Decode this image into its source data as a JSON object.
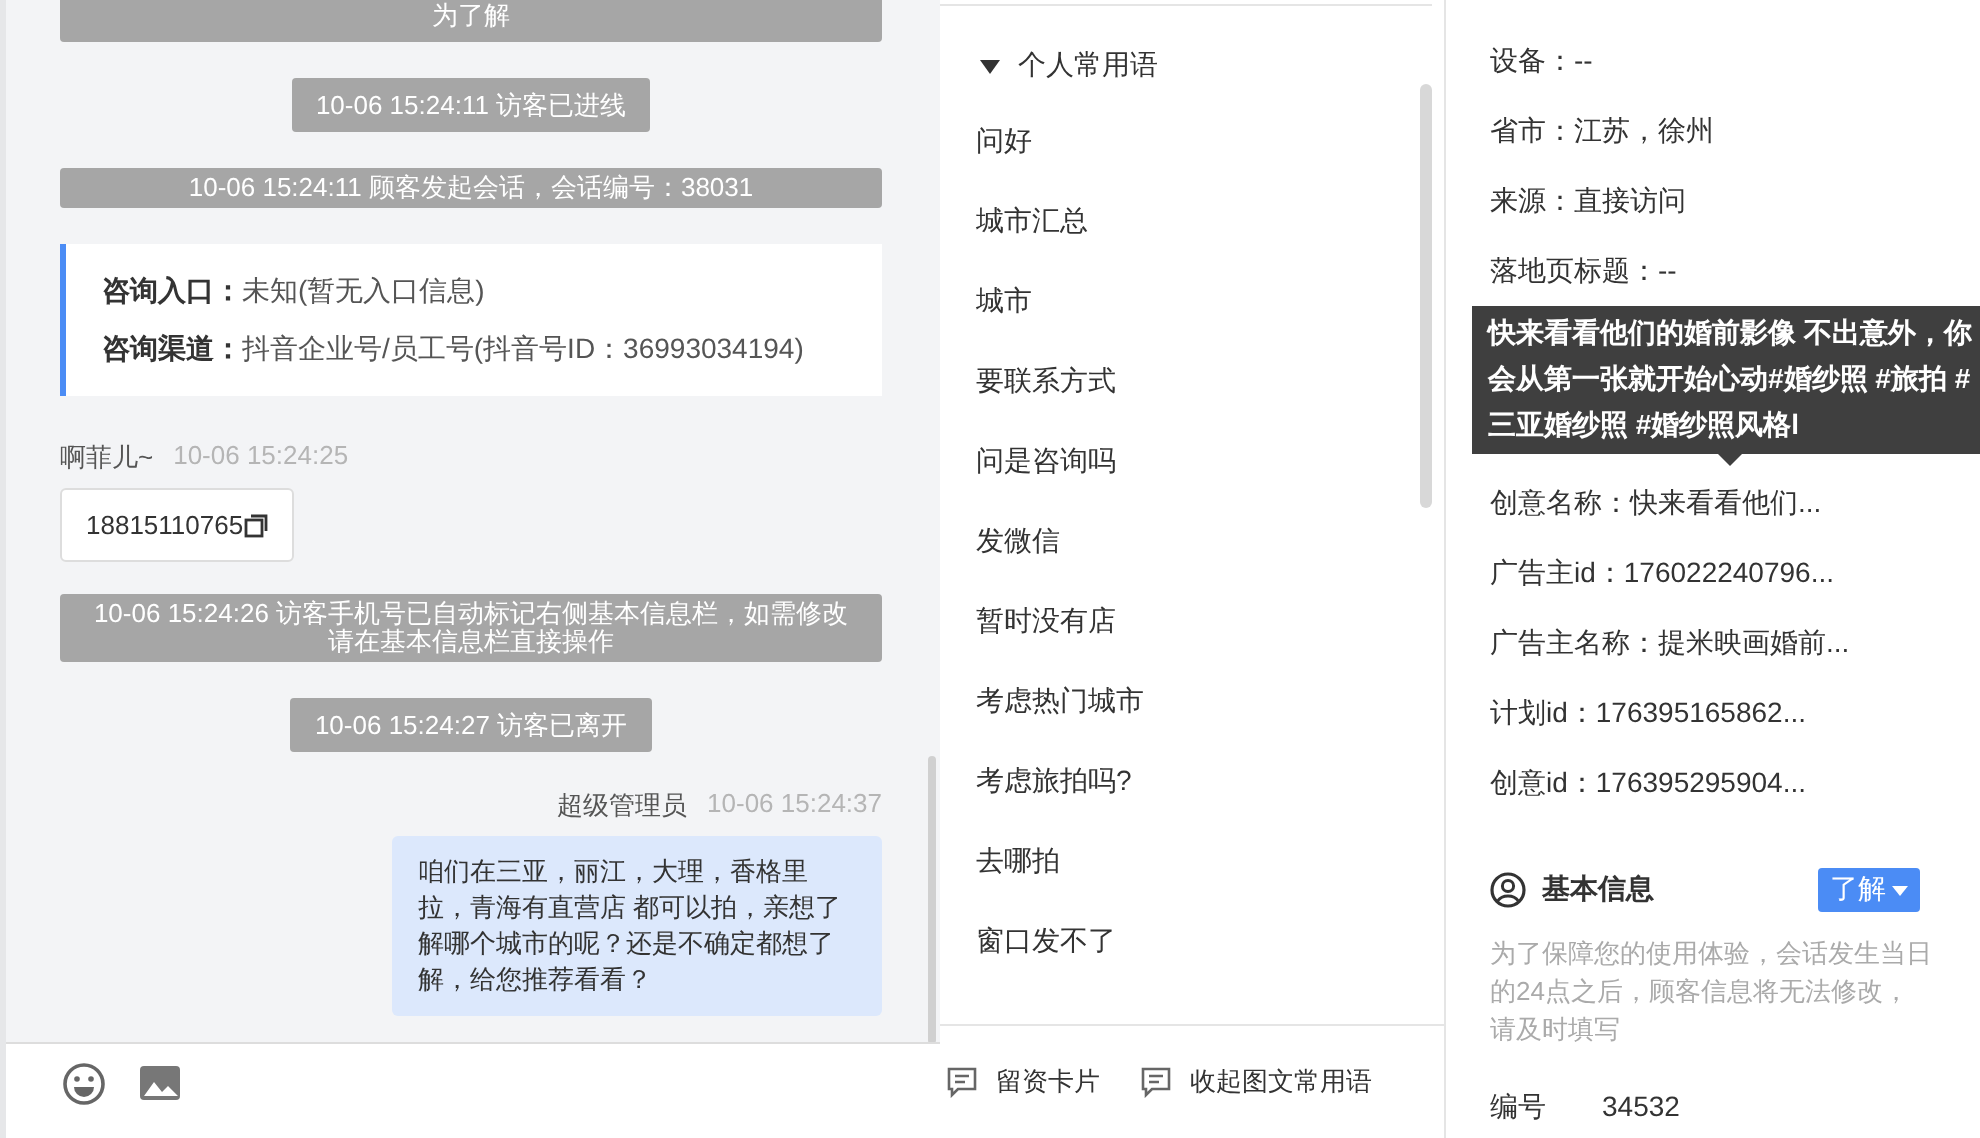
{
  "chat": {
    "messages": [
      {
        "kind": "system",
        "text": "为了解"
      },
      {
        "kind": "system",
        "text": "10-06 15:24:11 访客已进线"
      },
      {
        "kind": "system",
        "text": "10-06 15:24:11 顾客发起会话，会话编号：38031"
      },
      {
        "kind": "source",
        "fields": [
          {
            "label": "咨询入口：",
            "value": "未知(暂无入口信息)"
          },
          {
            "label": "咨询渠道：",
            "value": "抖音企业号/员工号(抖音号ID：36993034194)"
          }
        ]
      },
      {
        "kind": "visitor",
        "sender": "啊菲儿~",
        "time": "10-06 15:24:25",
        "text": "18815110765"
      },
      {
        "kind": "system",
        "text": "10-06 15:24:26 访客手机号已自动标记右侧基本信息栏，如需修改请在基本信息栏直接操作"
      },
      {
        "kind": "system",
        "text": "10-06 15:24:27 访客已离开"
      },
      {
        "kind": "agent",
        "sender": "超级管理员",
        "time": "10-06 15:24:37",
        "text": "咱们在三亚，丽江，大理，香格里拉，青海有直营店 都可以拍，亲想了解哪个城市的呢？还是不确定都想了解，给您推荐看看？"
      }
    ]
  },
  "phrases": {
    "group": {
      "title": "个人常用语",
      "expanded": true
    },
    "items": [
      "问好",
      "城市汇总",
      "城市",
      "要联系方式",
      "问是咨询吗",
      "发微信",
      "暂时没有店",
      "考虑热门城市",
      "考虑旅拍吗?",
      "去哪拍",
      "窗口发不了"
    ],
    "actions": [
      "留资卡片",
      "收起图文常用语"
    ]
  },
  "info": {
    "rows": [
      {
        "kind": "field",
        "text": "设备：--"
      },
      {
        "kind": "field",
        "text": "省市：江苏，徐州"
      },
      {
        "kind": "field",
        "text": "来源：直接访问"
      },
      {
        "kind": "field",
        "text": "落地页标题：--"
      },
      {
        "kind": "tooltip",
        "text": "快来看看他们的婚前影像 不出意外，你会从第一张就开始心动#婚纱照 #旅拍 #三亚婚纱照 #婚纱照风格l"
      },
      {
        "kind": "field",
        "text": "创意名称：快来看看他们..."
      },
      {
        "kind": "field",
        "text": "广告主id：176022240796..."
      },
      {
        "kind": "field",
        "text": "广告主名称：提米映画婚前..."
      },
      {
        "kind": "field",
        "text": "计划id：176395165862..."
      },
      {
        "kind": "field",
        "text": "创意id：176395295904..."
      }
    ],
    "section": {
      "title": "基本信息",
      "button": "了解",
      "note": "为了保障您的使用体验，会话发生当日的24点之后，顾客信息将无法修改，请及时填写",
      "fields": [
        {
          "label": "编号",
          "value": "34532"
        }
      ]
    }
  }
}
